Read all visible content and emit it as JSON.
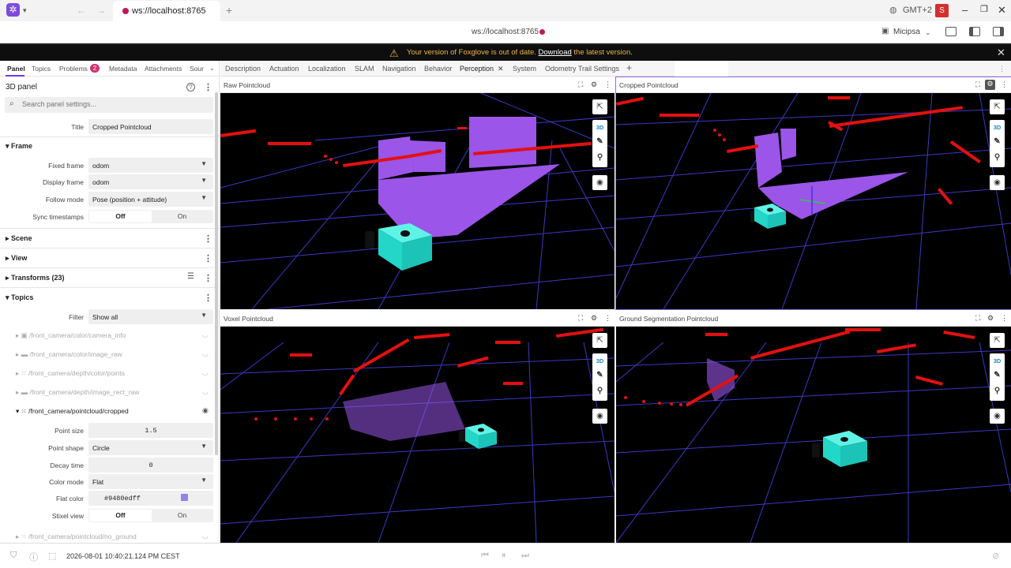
{
  "browser": {
    "tab_title": "ws://localhost:8765",
    "new_tab": "+",
    "timezone": "GMT+2",
    "profile_badge": "S",
    "url": "ws://localhost:8765",
    "profile_name": "Micipsa"
  },
  "banner": {
    "text_before": "Your version of Foxglove is out of date.",
    "link": "Download",
    "text_after": "the latest version."
  },
  "sidebar": {
    "tabs": [
      "Panel",
      "Topics",
      "Problems",
      "Metadata",
      "Attachments",
      "Sour"
    ],
    "problems_count": "2",
    "panel_title": "3D panel",
    "search_placeholder": "Search panel settings...",
    "title_label": "Title",
    "title_value": "Cropped Pointcloud",
    "frame": {
      "header": "Frame",
      "fixed_frame_label": "Fixed frame",
      "fixed_frame": "odom",
      "display_frame_label": "Display frame",
      "display_frame": "odom",
      "follow_mode_label": "Follow mode",
      "follow_mode": "Pose (position + attitude)",
      "sync_label": "Sync timestamps",
      "off": "Off",
      "on": "On"
    },
    "scene": "Scene",
    "view": "View",
    "transforms": "Transforms (23)",
    "topics": {
      "header": "Topics",
      "filter_label": "Filter",
      "filter_value": "Show all",
      "items": [
        "/front_camera/color/camera_info",
        "/front_camera/color/image_raw",
        "/front_camera/depth/color/points",
        "/front_camera/depth/image_rect_raw",
        "/front_camera/pointcloud/cropped",
        "/front_camera/pointcloud/no_ground"
      ]
    },
    "pointcloud": {
      "point_size_label": "Point size",
      "point_size": "1.5",
      "point_shape_label": "Point shape",
      "point_shape": "Circle",
      "decay_label": "Decay time",
      "decay": "0",
      "color_mode_label": "Color mode",
      "color_mode": "Flat",
      "flat_color_label": "Flat color",
      "flat_color": "#9480edff",
      "stixel_label": "Stixel view",
      "off": "Off",
      "on": "On"
    }
  },
  "layout_tabs": [
    "Description",
    "Actuation",
    "Localization",
    "SLAM",
    "Navigation",
    "Behavior",
    "Perception",
    "System",
    "Odometry Trail Settings"
  ],
  "panels": {
    "p1": "Raw Pointcloud",
    "p2": "Cropped Pointcloud",
    "p3": "Voxel Pointcloud",
    "p4": "Ground Segmentation Pointcloud",
    "mode_3d": "3D"
  },
  "colors": {
    "accent": "#6f3be8",
    "pointcloud": "#9480ed",
    "lidar": "#e31010",
    "robot": "#2ee6d6",
    "grid": "#3c3cc8",
    "banner_text": "#f0b541"
  },
  "status": {
    "timestamp": "2026-08-01 10:40:21.124 PM CEST"
  }
}
